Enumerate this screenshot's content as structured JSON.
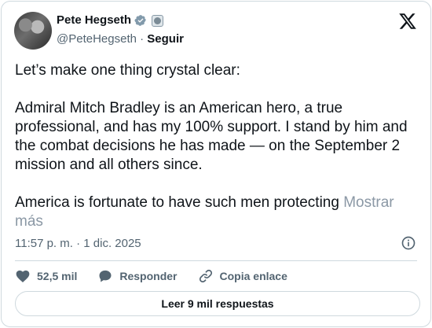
{
  "author": {
    "name": "Pete Hegseth",
    "handle": "@PeteHegseth",
    "separator": "·",
    "follow_label": "Seguir",
    "verified_icon": "verified-badge-icon",
    "affiliation_icon": "affiliation-badge-icon"
  },
  "brand": {
    "logo": "x-logo-icon"
  },
  "tweet": {
    "text": "Let’s make one thing crystal clear:\n\nAdmiral Mitch Bradley is an American hero, a true professional, and has my 100% support. I stand by him and the combat decisions he has made — on the September 2 mission and all others since.\n\nAmerica is fortunate to have such men protecting ",
    "more_label": "Mostrar más",
    "timestamp": "11:57 p. m. · 1 dic. 2025"
  },
  "actions": {
    "likes_count": "52,5 mil",
    "reply_label": "Responder",
    "copy_link_label": "Copia enlace"
  },
  "replies_button_label": "Leer 9 mil respuestas",
  "colors": {
    "text": "#0f1419",
    "secondary": "#536471",
    "border": "#cfd9de",
    "more_link": "#8b98a5"
  }
}
